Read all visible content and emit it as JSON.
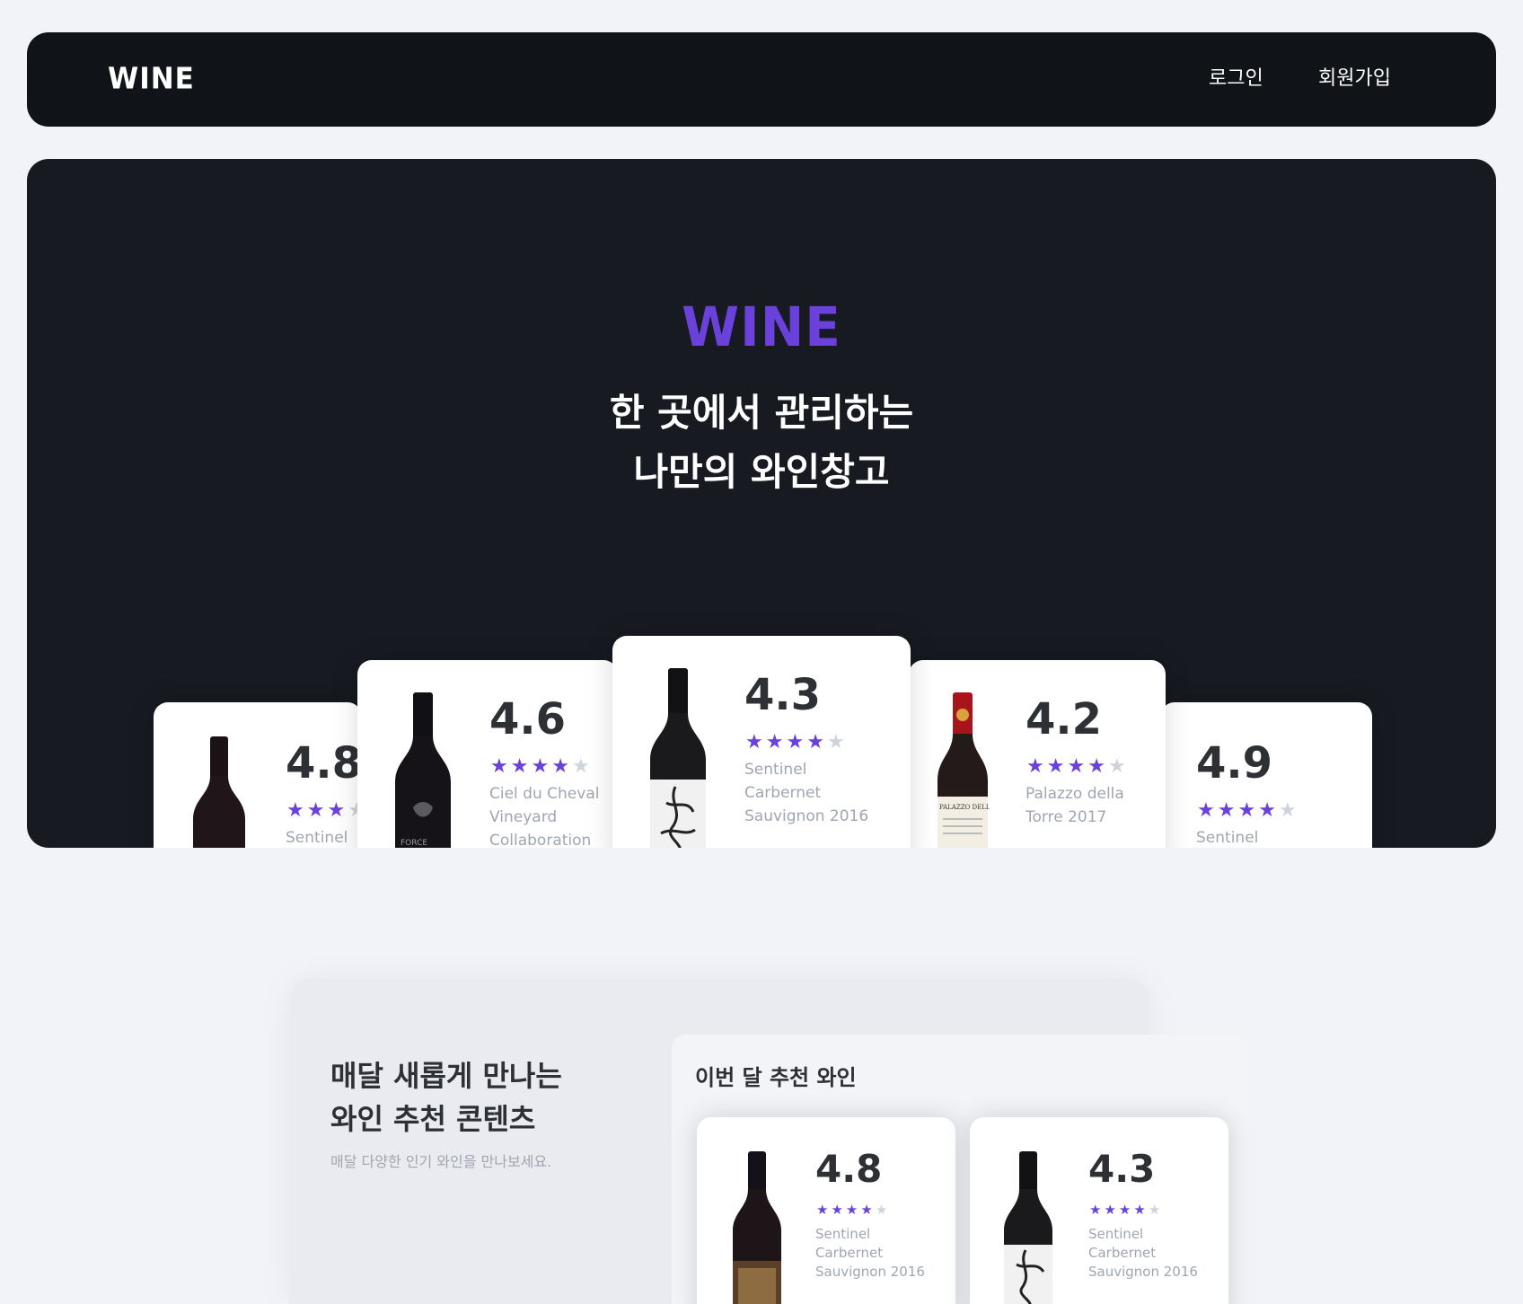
{
  "header": {
    "brand": "WINE",
    "login_label": "로그인",
    "signup_label": "회원가입"
  },
  "hero": {
    "logo": "WINE",
    "tagline_line1": "한 곳에서 관리하는",
    "tagline_line2": "나만의 와인창고",
    "cards": [
      {
        "score": "4.8",
        "rating": 3,
        "name_lines": [
          "Sentinel"
        ]
      },
      {
        "score": "4.6",
        "rating": 4,
        "name_lines": [
          "Ciel du Cheval",
          "Vineyard",
          "Collaboration"
        ]
      },
      {
        "score": "4.3",
        "rating": 4,
        "name_lines": [
          "Sentinel",
          "Carbernet",
          "Sauvignon 2016"
        ]
      },
      {
        "score": "4.2",
        "rating": 4,
        "name_lines": [
          "Palazzo della",
          "Torre 2017"
        ]
      },
      {
        "score": "4.9",
        "rating": 4,
        "name_lines": [
          "Sentinel"
        ]
      }
    ]
  },
  "recommend": {
    "title_line1": "매달 새롭게 만나는",
    "title_line2": "와인 추천 콘텐츠",
    "description": "매달 다양한 인기 와인을 만나보세요.",
    "panel_title": "이번 달 추천 와인",
    "cards": [
      {
        "score": "4.8",
        "rating": 4,
        "name_lines": [
          "Sentinel",
          "Carbernet",
          "Sauvignon 2016"
        ]
      },
      {
        "score": "4.3",
        "rating": 4,
        "name_lines": [
          "Sentinel",
          "Carbernet",
          "Sauvignon 2016"
        ]
      }
    ]
  },
  "colors": {
    "page_bg": "#f1f3f8",
    "dark_bg": "#171a21",
    "accent_purple": "#6a42db",
    "star_off": "#cfd4dc",
    "text_muted": "#9fa6b2"
  },
  "icons": [
    "wine-bottle-icon",
    "star-icon"
  ]
}
